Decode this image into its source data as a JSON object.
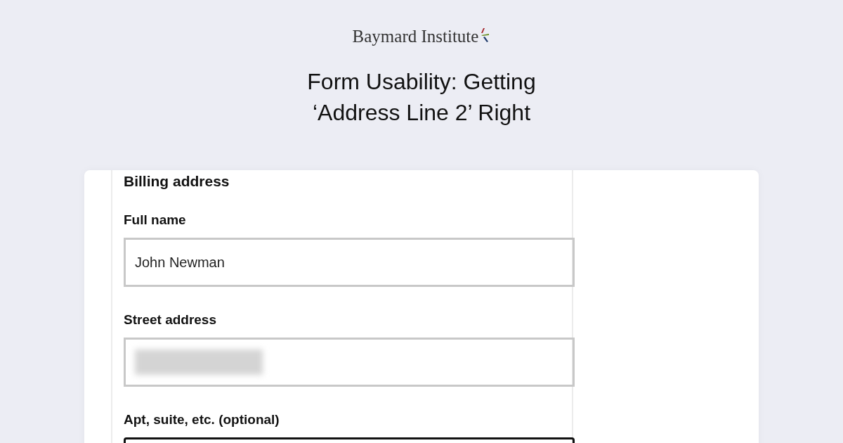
{
  "logo": {
    "text": "Baymard Institute"
  },
  "headline": {
    "lines": [
      "Form Usability: Getting",
      "‘Address Line 2’ Right"
    ]
  },
  "form": {
    "heading": "Billing address",
    "fields": [
      {
        "label": "Full name",
        "kind": "text",
        "value": "John Newman",
        "focused": false
      },
      {
        "label": "Street address",
        "kind": "redacted",
        "focused": false
      },
      {
        "label": "Apt, suite, etc. (optional)",
        "kind": "text",
        "focused": true
      }
    ]
  }
}
